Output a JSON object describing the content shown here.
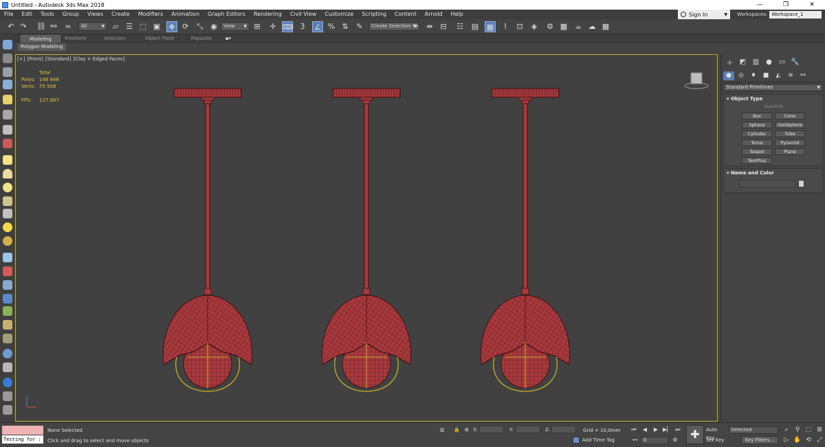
{
  "window": {
    "title": "Untitled - Autodesk 3ds Max 2018",
    "controls": [
      "—",
      "❐",
      "✕"
    ]
  },
  "menu": [
    "File",
    "Edit",
    "Tools",
    "Group",
    "Views",
    "Create",
    "Modifiers",
    "Animation",
    "Graph Editors",
    "Rendering",
    "Civil View",
    "Customize",
    "Scripting",
    "Content",
    "Arnold",
    "Help"
  ],
  "account": {
    "signin": "Sign In",
    "workspaces_label": "Workspaces:",
    "workspace": "Workspace_1"
  },
  "toolbar": {
    "filter": "All",
    "ref_coord": "View",
    "selection_set": "Create Selection Se"
  },
  "ribbon": {
    "tabs": [
      "Modeling",
      "Freeform",
      "Selection",
      "Object Paint",
      "Populate"
    ],
    "active_tab": "Modeling",
    "sub": "Polygon Modeling"
  },
  "viewport": {
    "label_parts": [
      "[+]",
      "[Front]",
      "[Standard]",
      "[Clay + Edged Faces]"
    ],
    "stats": {
      "total_label": "Total",
      "polys_label": "Polys:",
      "polys": "148 848",
      "verts_label": "Verts:",
      "verts": "75 508",
      "fps_label": "FPS:",
      "fps": "127,667"
    }
  },
  "command_panel": {
    "category": "Standard Primitives",
    "object_type": {
      "title": "Object Type",
      "autogrid": "AutoGrid",
      "buttons": [
        "Box",
        "Cone",
        "Sphere",
        "GeoSphere",
        "Cylinder",
        "Tube",
        "Torus",
        "Pyramid",
        "Teapot",
        "Plane",
        "TextPlus"
      ]
    },
    "name_and_color": {
      "title": "Name and Color"
    }
  },
  "status": {
    "maxscript_text": "Testing for :",
    "selection": "None Selected",
    "prompt": "Click and drag to select and move objects",
    "x_label": "X:",
    "y_label": "Y:",
    "z_label": "Z:",
    "grid": "Grid = 10,0mm",
    "add_time_tag": "Add Time Tag",
    "frame": "0",
    "auto_key": "Auto Key",
    "set_key": "Set Key",
    "key_mode": "Selected",
    "key_filters": "Key Filters..."
  },
  "colors": {
    "lamp_fill": "#a8393d",
    "wire": "#3b1214",
    "selection_outline": "#c5b027",
    "stats_text": "#e3c23a"
  }
}
